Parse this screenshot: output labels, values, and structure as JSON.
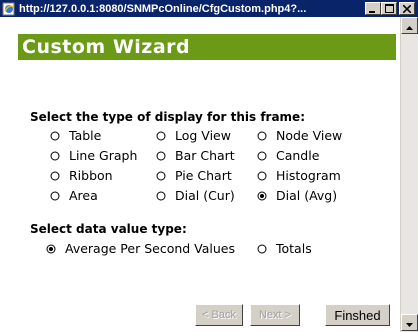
{
  "window": {
    "title": "http://127.0.0.1:8080/SNMPcOnline/CfgCustom.php4?...",
    "controls": {
      "minimize": "minimize-icon",
      "maximize": "maximize-icon",
      "close": "close-icon"
    }
  },
  "header": {
    "title": "Custom Wizard",
    "color": "#6b9a16"
  },
  "display_type": {
    "label": "Select the type of display for this frame:",
    "options": [
      {
        "label": "Table",
        "selected": false
      },
      {
        "label": "Log View",
        "selected": false
      },
      {
        "label": "Node View",
        "selected": false
      },
      {
        "label": "Line Graph",
        "selected": false
      },
      {
        "label": "Bar Chart",
        "selected": false
      },
      {
        "label": "Candle",
        "selected": false
      },
      {
        "label": "Ribbon",
        "selected": false
      },
      {
        "label": "Pie Chart",
        "selected": false
      },
      {
        "label": "Histogram",
        "selected": false
      },
      {
        "label": "Area",
        "selected": false
      },
      {
        "label": "Dial (Cur)",
        "selected": false
      },
      {
        "label": "Dial (Avg)",
        "selected": true
      }
    ]
  },
  "value_type": {
    "label": "Select data value type:",
    "options": [
      {
        "label": "Average Per Second Values",
        "selected": true
      },
      {
        "label": "Totals",
        "selected": false
      }
    ]
  },
  "buttons": {
    "back": "< Back",
    "next": "Next >",
    "finish": "Finshed"
  }
}
